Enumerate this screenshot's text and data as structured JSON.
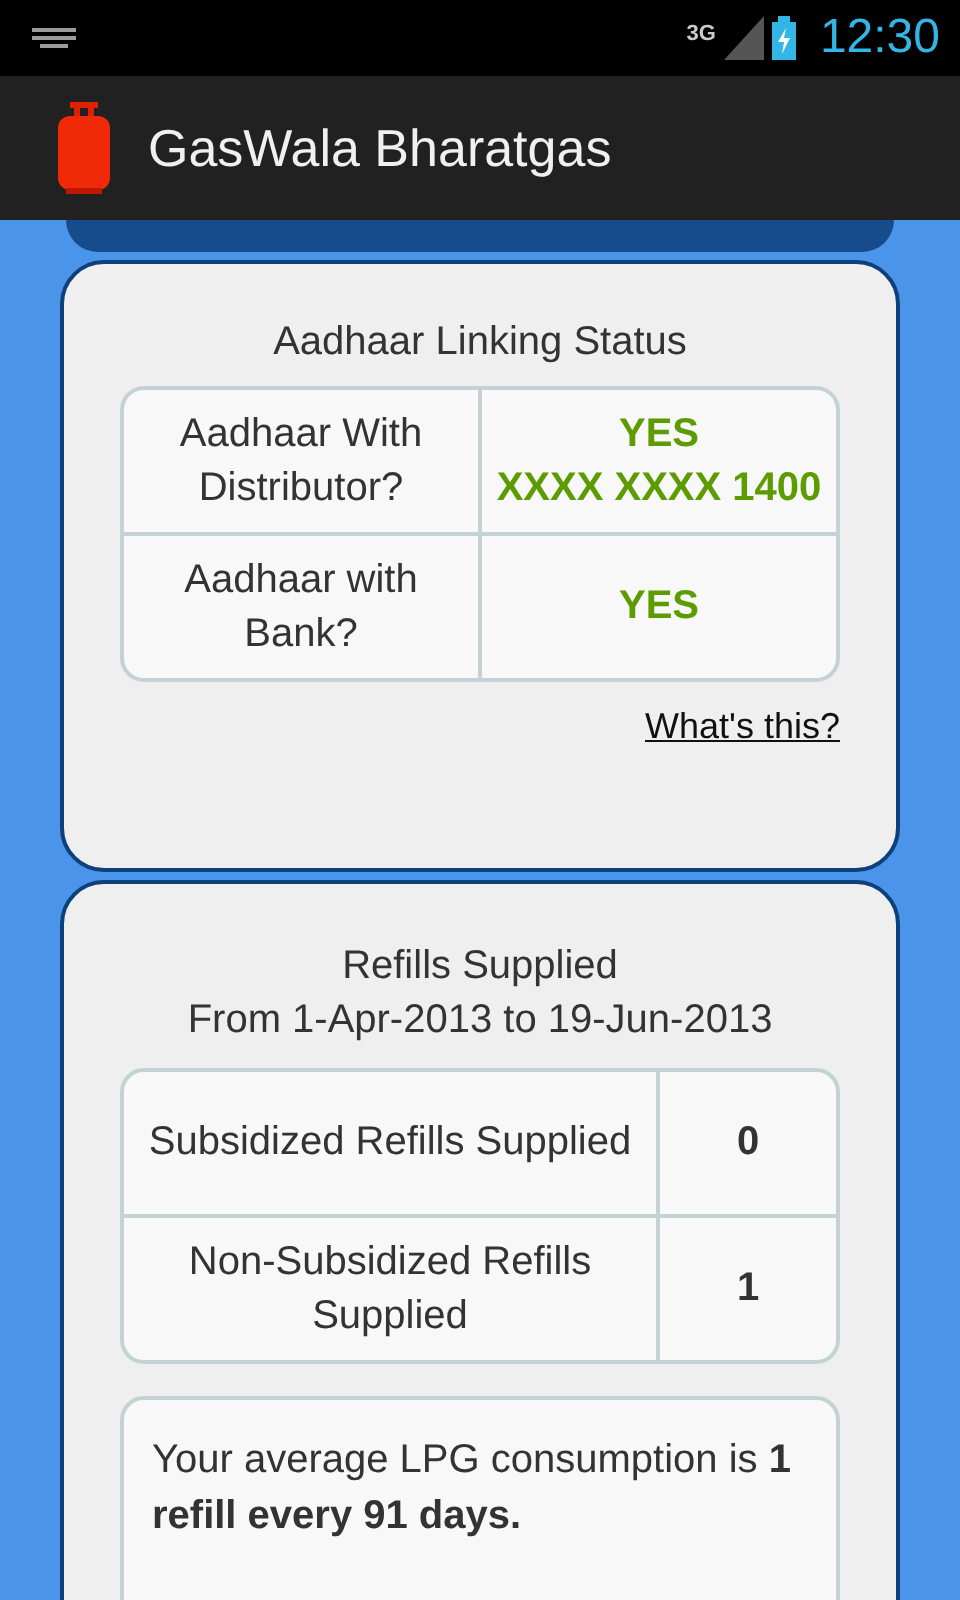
{
  "status_bar": {
    "network": "3G",
    "time": "12:30"
  },
  "app_bar": {
    "title": "GasWala Bharatgas"
  },
  "aadhaar_card": {
    "title": "Aadhaar Linking Status",
    "rows": [
      {
        "label": "Aadhaar With Distributor?",
        "values": [
          "YES",
          "XXXX XXXX 1400"
        ]
      },
      {
        "label": "Aadhaar with Bank?",
        "values": [
          "YES"
        ]
      }
    ],
    "link": "What's this?"
  },
  "refills_card": {
    "title": "Refills Supplied",
    "subtitle": "From 1-Apr-2013 to 19-Jun-2013",
    "rows": [
      {
        "label": "Subsidized Refills Supplied",
        "value": "0"
      },
      {
        "label": "Non-Subsidized Refills Supplied",
        "value": "1"
      }
    ],
    "note": "Your average LPG consumption is **1 refill every 91 days.**"
  }
}
